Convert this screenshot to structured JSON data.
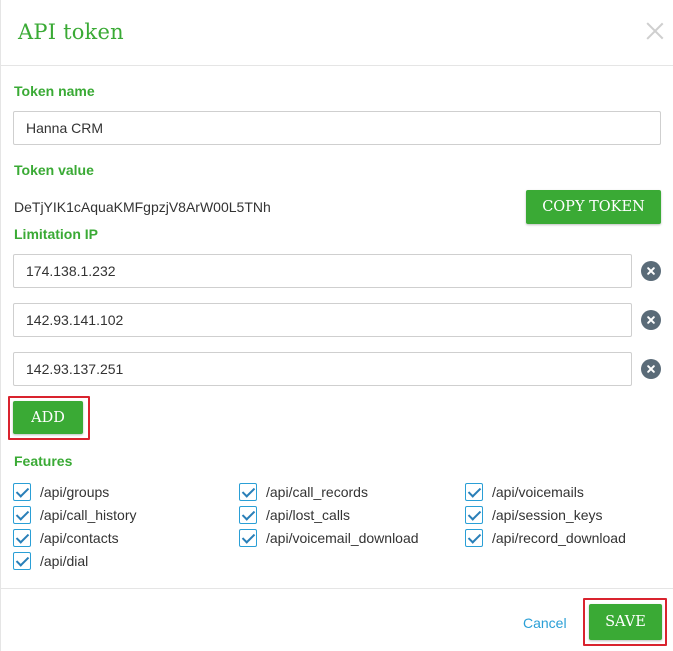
{
  "dialog": {
    "title": "API token"
  },
  "token_name": {
    "label": "Token name",
    "value": "Hanna CRM"
  },
  "token_value": {
    "label": "Token value",
    "value": "DeTjYIK1cAquaKMFgpzjV8ArW00L5TNh",
    "copy_label": "COPY TOKEN"
  },
  "limitation_ip": {
    "label": "Limitation IP",
    "ips": [
      "174.138.1.232",
      "142.93.141.102",
      "142.93.137.251"
    ],
    "add_label": "ADD"
  },
  "features": {
    "label": "Features",
    "items": [
      "/api/groups",
      "/api/call_records",
      "/api/voicemails",
      "/api/call_history",
      "/api/lost_calls",
      "/api/session_keys",
      "/api/contacts",
      "/api/voicemail_download",
      "/api/record_download",
      "/api/dial"
    ]
  },
  "footer": {
    "cancel_label": "Cancel",
    "save_label": "SAVE"
  },
  "colors": {
    "accent": "#3aaa35",
    "link": "#2a9fd6",
    "highlight": "#d9232e"
  }
}
